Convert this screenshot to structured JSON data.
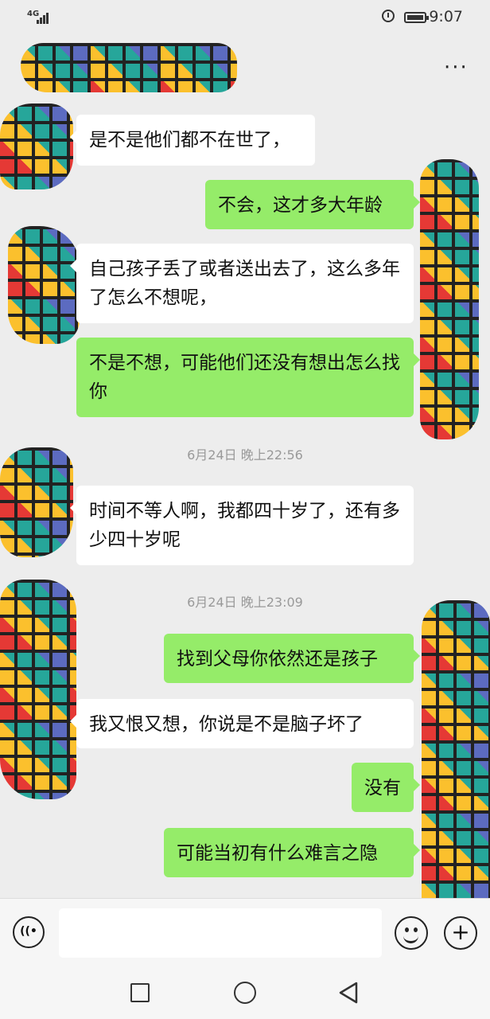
{
  "status_bar": {
    "network": "4G",
    "time": "9:07"
  },
  "header": {
    "more_label": "···"
  },
  "messages": [
    {
      "side": "left",
      "text": "是不是他们都不在世了，"
    },
    {
      "side": "right",
      "text": "不会，这才多大年龄"
    },
    {
      "side": "left",
      "text": "自己孩子丢了或者送出去了，这么多年了怎么不想呢，"
    },
    {
      "side": "right",
      "text": "不是不想，可能他们还没有想出怎么找你"
    },
    {
      "side": "left",
      "text": "时间不等人啊，我都四十岁了，还有多少四十岁呢"
    },
    {
      "side": "right",
      "text": "找到父母你依然还是孩子"
    },
    {
      "side": "left",
      "text": "我又恨又想，你说是不是脑子坏了"
    },
    {
      "side": "right",
      "text": "没有"
    },
    {
      "side": "right",
      "text": "可能当初有什么难言之隐"
    }
  ],
  "timestamps": [
    "6月24日 晚上22:56",
    "6月24日 晚上23:09"
  ],
  "input_bar": {
    "value": "",
    "placeholder": "",
    "voice_icon": "voice-icon",
    "emoji_icon": "emoji-icon",
    "plus_icon": "plus-icon"
  },
  "nav_bar": {
    "icons": [
      "recent-apps-icon",
      "home-icon",
      "back-icon"
    ]
  }
}
